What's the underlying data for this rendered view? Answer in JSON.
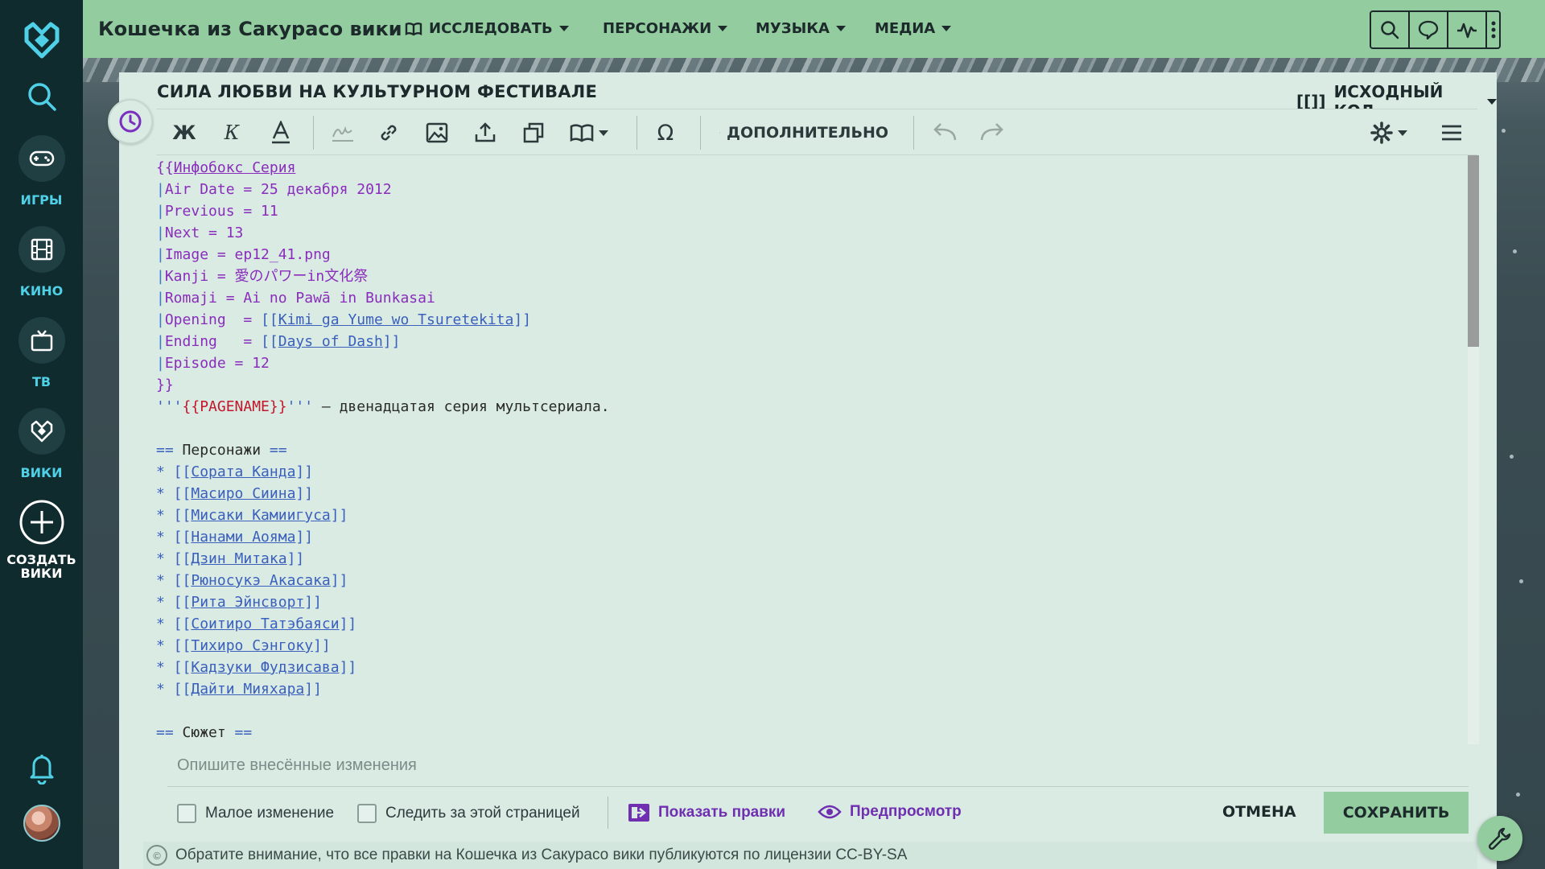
{
  "rail": {
    "games_label": "ИГРЫ",
    "movies_label": "КИНО",
    "tv_label": "ТВ",
    "wikis_label": "ВИКИ",
    "create_label_1": "СОЗДАТЬ",
    "create_label_2": "ВИКИ"
  },
  "topbar": {
    "wiki_title": "Кошечка из Сакурасо вики",
    "nav": {
      "explore": "ИССЛЕДОВАТЬ",
      "characters": "ПЕРСОНАЖИ",
      "music": "МУЗЫКА",
      "media": "МЕДИА"
    },
    "tools": [
      "search-icon",
      "discussion-icon",
      "activity-icon",
      "more-icon"
    ]
  },
  "editor": {
    "page_title": "СИЛА ЛЮБВИ НА КУЛЬТУРНОМ ФЕСТИВАЛЕ",
    "source_mode_icon": "[[]]",
    "source_mode_label": "ИСХОДНЫЙ КОД",
    "toolbar": {
      "bold": "Ж",
      "italic": "К",
      "omega": "Ω",
      "advanced": "ДОПОЛНИТЕЛЬНО"
    },
    "code_lines": {
      "l1_open": "{{",
      "l1_name": "Инфобокс Серия",
      "l2": "Air Date = 25 декабря 2012",
      "l3": "Previous = 11",
      "l4": "Next = 13",
      "l5": "Image = ep12_41.png",
      "l6": "Kanji = 愛のパワーin文化祭",
      "l7": "Romaji = Ai no Pawā in Bunkasai",
      "l8_key": "Opening  = ",
      "l8_link": "Kimi ga Yume wo Tsuretekita",
      "l9_key": "Ending   = ",
      "l9_link": "Days of Dash",
      "l10": "Episode = 12",
      "l11": "}}",
      "l12_q1": "'''",
      "l12_magic": "{{PAGENAME}}",
      "l12_q2": "'''",
      "l12_rest": " — двенадцатая серия мультсериала.",
      "section1_title": " Персонажи ",
      "section2_title": " Сюжет "
    },
    "characters": [
      "Сората Канда",
      "Масиро Сиина",
      "Мисаки Камиигуса",
      "Нанами Аояма",
      "Дзин Митака",
      "Рюносукэ Акасака",
      "Рита Эйнсворт",
      "Соитиро Татэбаяси",
      "Тихиро Сэнгоку",
      "Кадзуки Фудзисава",
      "Дайти Мияхара"
    ],
    "summary_placeholder": "Опишите внесённые изменения",
    "minor_edit": "Малое изменение",
    "watch_page": "Следить за этой страницей",
    "show_changes": "Показать правки",
    "preview": "Предпросмотр",
    "cancel": "ОТМЕНА",
    "save": "СОХРАНИТЬ",
    "license_badge": "©",
    "license_text": "Обратите внимание, что все правки на Кошечка из Сакурасо вики публикуются по лицензии CC-BY-SA"
  },
  "colors": {
    "accent": "#93cc9e",
    "rail_bg": "#0f2b2e",
    "rail_label": "#4fd0e6",
    "link_purple": "#6f2fb0"
  }
}
